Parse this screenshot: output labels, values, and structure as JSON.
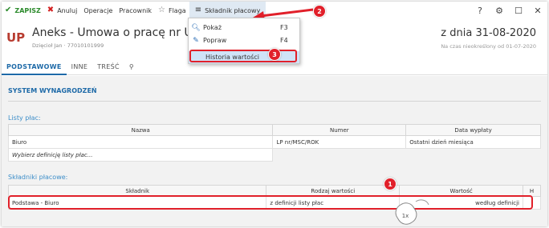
{
  "toolbar": {
    "save_label": "ZAPISZ",
    "cancel_label": "Anuluj",
    "operations_label": "Operacje",
    "employee_label": "Pracownik",
    "flag_label": "Flaga",
    "pay_component_label": "Składnik płacowy"
  },
  "header": {
    "initials": "UP",
    "title": "Aneks - Umowa o pracę nr UP 1/",
    "subtitle": "Dzięcioł Jan  ·  77010101999",
    "date": "z dnia 31-08-2020",
    "date_sub": "Na czas nieokreślony od 01-07-2020"
  },
  "tabs": [
    "PODSTAWOWE",
    "INNE",
    "TREŚĆ"
  ],
  "section": {
    "title": "SYSTEM WYNAGRODZEŃ"
  },
  "payroll_lists": {
    "label": "Listy płac:",
    "columns": [
      "Nazwa",
      "Numer",
      "Data wypłaty"
    ],
    "rows": [
      [
        "Biuro",
        "LP nr/MSC/ROK",
        "Ostatni dzień miesiąca"
      ]
    ],
    "placeholder": "Wybierz definicję listy płac..."
  },
  "pay_components": {
    "label": "Składniki płacowe:",
    "columns": [
      "Składnik",
      "Rodzaj wartości",
      "Wartość",
      "H"
    ],
    "rows": [
      [
        "Podstawa - Biuro",
        "z definicji listy płac",
        "według definicji",
        ""
      ]
    ]
  },
  "dropdown": {
    "items": [
      {
        "label": "Pokaż",
        "key": "F3",
        "icon": "search-icon"
      },
      {
        "label": "Popraw",
        "key": "F4",
        "icon": "pencil-icon"
      },
      {
        "label": "Historia wartości",
        "key": "",
        "icon": ""
      }
    ]
  },
  "annotations": {
    "badge1": "1",
    "badge2": "2",
    "badge3": "3",
    "click": "1x"
  },
  "colors": {
    "accent": "#1e6aa8",
    "annotation_red": "#e1202a",
    "save_green": "#2b8a2b",
    "brand_red": "#b83c30"
  }
}
